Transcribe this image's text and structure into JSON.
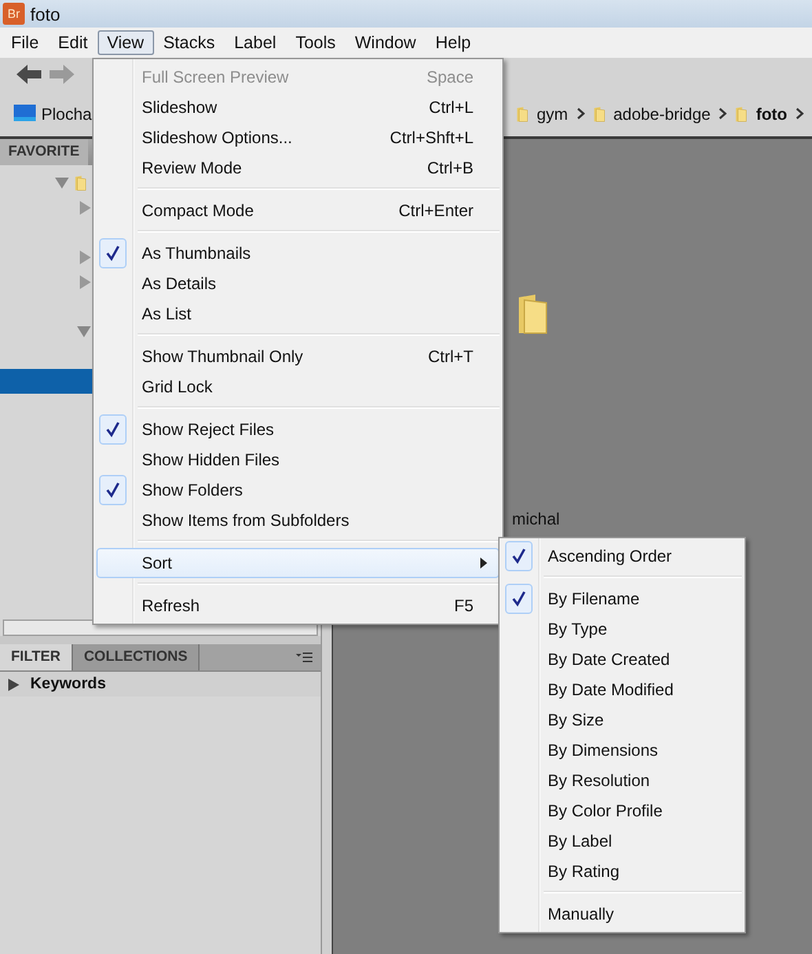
{
  "window": {
    "app_badge": "Br",
    "title": "foto"
  },
  "menu_bar": [
    {
      "label": "File",
      "selected": false
    },
    {
      "label": "Edit",
      "selected": false
    },
    {
      "label": "View",
      "selected": true
    },
    {
      "label": "Stacks",
      "selected": false
    },
    {
      "label": "Label",
      "selected": false
    },
    {
      "label": "Tools",
      "selected": false
    },
    {
      "label": "Window",
      "selected": false
    },
    {
      "label": "Help",
      "selected": false
    }
  ],
  "path_bar": {
    "shortcut": "Plocha",
    "crumbs": [
      {
        "label": "gym",
        "selected": false
      },
      {
        "label": "adobe-bridge",
        "selected": false
      },
      {
        "label": "foto",
        "selected": true
      }
    ]
  },
  "favorites_panel": {
    "tab": "FAVORITE"
  },
  "filter_panel": {
    "tabs": [
      {
        "label": "FILTER",
        "selected": true
      },
      {
        "label": "COLLECTIONS",
        "selected": false
      }
    ],
    "rows": [
      {
        "label": "Keywords",
        "expanded": false
      }
    ]
  },
  "content": {
    "items": [
      {
        "kind": "folder",
        "label": "michal"
      }
    ]
  },
  "view_menu": [
    {
      "kind": "item",
      "label": "Full Screen Preview",
      "shortcut": "Space",
      "checked": false,
      "disabled": true,
      "selected": false
    },
    {
      "kind": "item",
      "label": "Slideshow",
      "shortcut": "Ctrl+L",
      "checked": false,
      "disabled": false,
      "selected": false
    },
    {
      "kind": "item",
      "label": "Slideshow Options...",
      "shortcut": "Ctrl+Shft+L",
      "checked": false,
      "disabled": false,
      "selected": false
    },
    {
      "kind": "item",
      "label": "Review Mode",
      "shortcut": "Ctrl+B",
      "checked": false,
      "disabled": false,
      "selected": false
    },
    {
      "kind": "separator"
    },
    {
      "kind": "item",
      "label": "Compact Mode",
      "shortcut": "Ctrl+Enter",
      "checked": false,
      "disabled": false,
      "selected": false
    },
    {
      "kind": "separator"
    },
    {
      "kind": "item",
      "label": "As Thumbnails",
      "checked": true,
      "disabled": false,
      "selected": false
    },
    {
      "kind": "item",
      "label": "As Details",
      "checked": false,
      "disabled": false,
      "selected": false
    },
    {
      "kind": "item",
      "label": "As List",
      "checked": false,
      "disabled": false,
      "selected": false
    },
    {
      "kind": "separator"
    },
    {
      "kind": "item",
      "label": "Show Thumbnail Only",
      "shortcut": "Ctrl+T",
      "checked": false,
      "disabled": false,
      "selected": false
    },
    {
      "kind": "item",
      "label": "Grid Lock",
      "checked": false,
      "disabled": false,
      "selected": false
    },
    {
      "kind": "separator"
    },
    {
      "kind": "item",
      "label": "Show Reject Files",
      "checked": true,
      "disabled": false,
      "selected": false
    },
    {
      "kind": "item",
      "label": "Show Hidden Files",
      "checked": false,
      "disabled": false,
      "selected": false
    },
    {
      "kind": "item",
      "label": "Show Folders",
      "checked": true,
      "disabled": false,
      "selected": false
    },
    {
      "kind": "item",
      "label": "Show Items from Subfolders",
      "checked": false,
      "disabled": false,
      "selected": false
    },
    {
      "kind": "separator"
    },
    {
      "kind": "item",
      "label": "Sort",
      "checked": false,
      "disabled": false,
      "selected": true,
      "submenu": true
    },
    {
      "kind": "separator"
    },
    {
      "kind": "item",
      "label": "Refresh",
      "shortcut": "F5",
      "checked": false,
      "disabled": false,
      "selected": false
    }
  ],
  "sort_submenu": [
    {
      "kind": "item",
      "label": "Ascending Order",
      "checked": true
    },
    {
      "kind": "separator"
    },
    {
      "kind": "item",
      "label": "By Filename",
      "checked": true
    },
    {
      "kind": "item",
      "label": "By Type",
      "checked": false
    },
    {
      "kind": "item",
      "label": "By Date Created",
      "checked": false
    },
    {
      "kind": "item",
      "label": "By Date Modified",
      "checked": false
    },
    {
      "kind": "item",
      "label": "By Size",
      "checked": false
    },
    {
      "kind": "item",
      "label": "By Dimensions",
      "checked": false
    },
    {
      "kind": "item",
      "label": "By Resolution",
      "checked": false
    },
    {
      "kind": "item",
      "label": "By Color Profile",
      "checked": false
    },
    {
      "kind": "item",
      "label": "By Label",
      "checked": false
    },
    {
      "kind": "item",
      "label": "By Rating",
      "checked": false
    },
    {
      "kind": "separator"
    },
    {
      "kind": "item",
      "label": "Manually",
      "checked": false
    }
  ]
}
